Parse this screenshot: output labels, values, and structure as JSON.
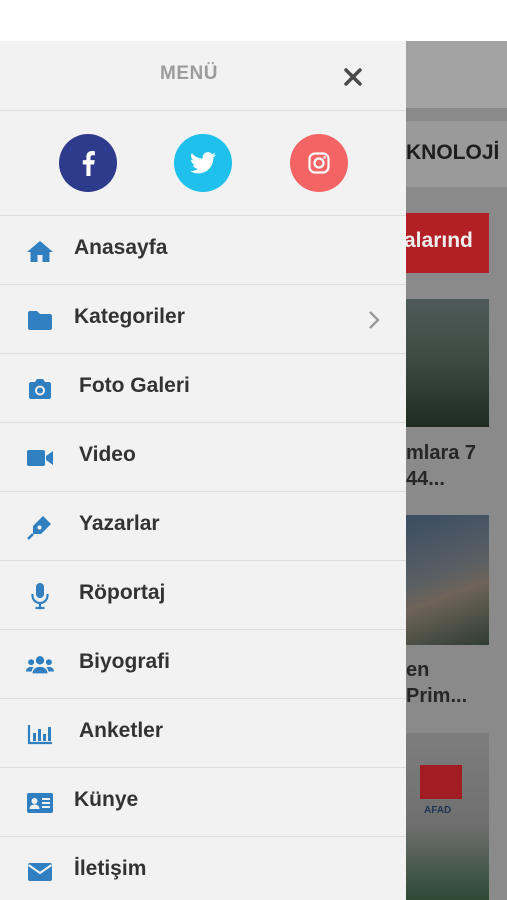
{
  "menu": {
    "title": "MENÜ",
    "close_icon": "close-icon"
  },
  "social": [
    {
      "name": "facebook",
      "icon": "facebook-icon",
      "color": "#2e3a8c"
    },
    {
      "name": "twitter",
      "icon": "twitter-icon",
      "color": "#1fc1ec"
    },
    {
      "name": "instagram",
      "icon": "instagram-icon",
      "color": "#f46464"
    }
  ],
  "menu_items": [
    {
      "label": "Anasayfa",
      "icon": "home-icon"
    },
    {
      "label": "Kategoriler",
      "icon": "folder-icon",
      "has_submenu": true
    },
    {
      "label": "Foto Galeri",
      "icon": "camera-icon"
    },
    {
      "label": "Video",
      "icon": "video-camera-icon"
    },
    {
      "label": "Yazarlar",
      "icon": "pen-icon"
    },
    {
      "label": "Röportaj",
      "icon": "microphone-icon"
    },
    {
      "label": "Biyografi",
      "icon": "users-icon"
    },
    {
      "label": "Anketler",
      "icon": "bar-chart-icon"
    },
    {
      "label": "Künye",
      "icon": "id-card-icon"
    },
    {
      "label": "İletişim",
      "icon": "envelope-icon"
    }
  ],
  "background_page": {
    "category_tab": "KNOLOJİ",
    "red_banner": "alarınd",
    "article1_line1": "mlara 7",
    "article1_line2": "44...",
    "article2_line1": "en",
    "article2_line2": "Prim...",
    "image3_caption": "AFAD"
  },
  "colors": {
    "accent": "#2f7fc1",
    "drawer_bg": "#f2f2f2",
    "text": "#333333",
    "red": "#b21f24"
  }
}
